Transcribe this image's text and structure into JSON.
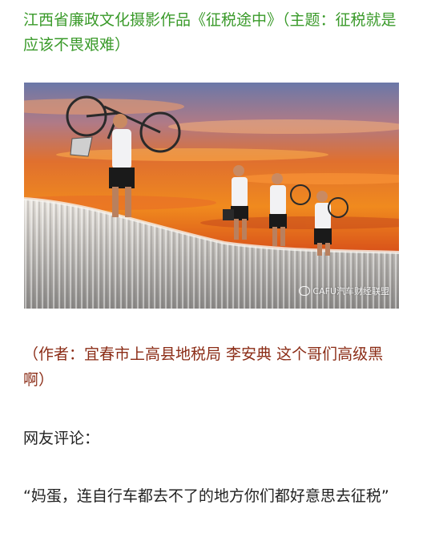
{
  "article": {
    "title": "江西省廉政文化摄影作品《征税途中》（主题：征税就是应该不畏艰难）",
    "credit": "（作者：宜春市上高县地税局 李安典 这个哥们高级黑啊）",
    "comment_heading": "网友评论：",
    "comment_text": "“妈蛋，连自行车都去不了的地方你们都好意思去征税”"
  },
  "photo": {
    "watermark": "CAFU汽车财经联盟",
    "watermark_icon": "wechat-icon"
  },
  "colors": {
    "title": "#3a9a2a",
    "credit": "#8b2c16",
    "body_text": "#222222"
  }
}
